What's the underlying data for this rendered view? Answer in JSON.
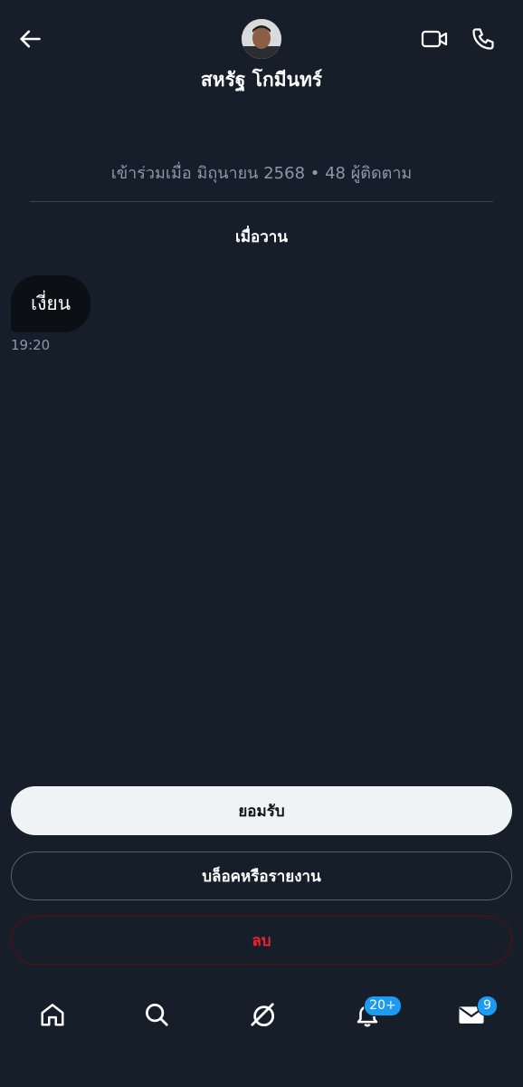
{
  "header": {
    "display_name": "สหรัฐ โกมีนทร์",
    "back_icon": "arrow-left-icon",
    "video_icon": "video-camera-icon",
    "call_icon": "phone-icon"
  },
  "profile": {
    "meta": "เข้าร่วมเมื่อ มิถุนายน 2568 • 48 ผู้ติดตาม"
  },
  "conversation": {
    "date_label": "เมื่อวาน",
    "messages": [
      {
        "text": "เงี่ยน",
        "time": "19:20"
      }
    ]
  },
  "actions": {
    "accept_label": "ยอมรับ",
    "block_report_label": "บล็อคหรือรายงาน",
    "delete_label": "ลบ"
  },
  "bottom_nav": {
    "items": [
      {
        "icon": "home-icon"
      },
      {
        "icon": "search-icon"
      },
      {
        "icon": "grok-icon"
      },
      {
        "icon": "bell-icon",
        "badge": "20+"
      },
      {
        "icon": "mail-icon",
        "badge": "9"
      }
    ]
  },
  "colors": {
    "background": "#161e29",
    "accent": "#1d9bf0",
    "danger": "#f4212e"
  }
}
